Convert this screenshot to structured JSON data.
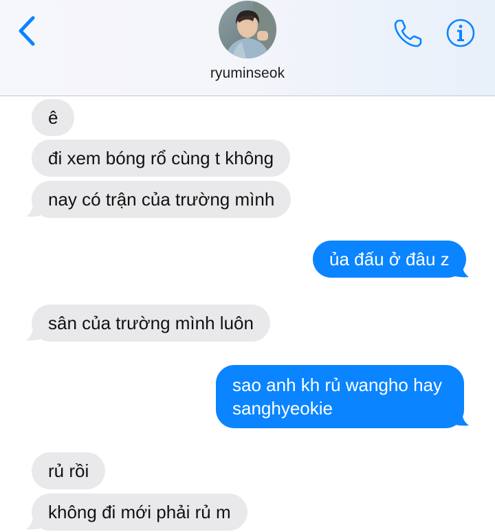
{
  "header": {
    "contact_name": "ryuminseok",
    "back_icon": "chevron-left-icon",
    "call_icon": "phone-icon",
    "info_icon": "info-icon",
    "accent_color": "#0a84ff"
  },
  "messages": [
    {
      "direction": "incoming",
      "text": "ê"
    },
    {
      "direction": "incoming",
      "text": "đi xem bóng rổ cùng t không"
    },
    {
      "direction": "incoming",
      "text": "nay có trận của trường mình"
    },
    {
      "direction": "outgoing",
      "text": "ủa đấu ở đâu z"
    },
    {
      "direction": "incoming",
      "text": "sân của trường mình luôn"
    },
    {
      "direction": "outgoing",
      "text": "sao anh kh rủ wangho hay sanghyeokie"
    },
    {
      "direction": "incoming",
      "text": "rủ rồi"
    },
    {
      "direction": "incoming",
      "text": "không đi mới phải rủ m"
    }
  ],
  "colors": {
    "incoming_bubble": "#e9e9eb",
    "outgoing_bubble": "#0a84ff",
    "outgoing_text": "#ffffff",
    "incoming_text": "#111111"
  }
}
